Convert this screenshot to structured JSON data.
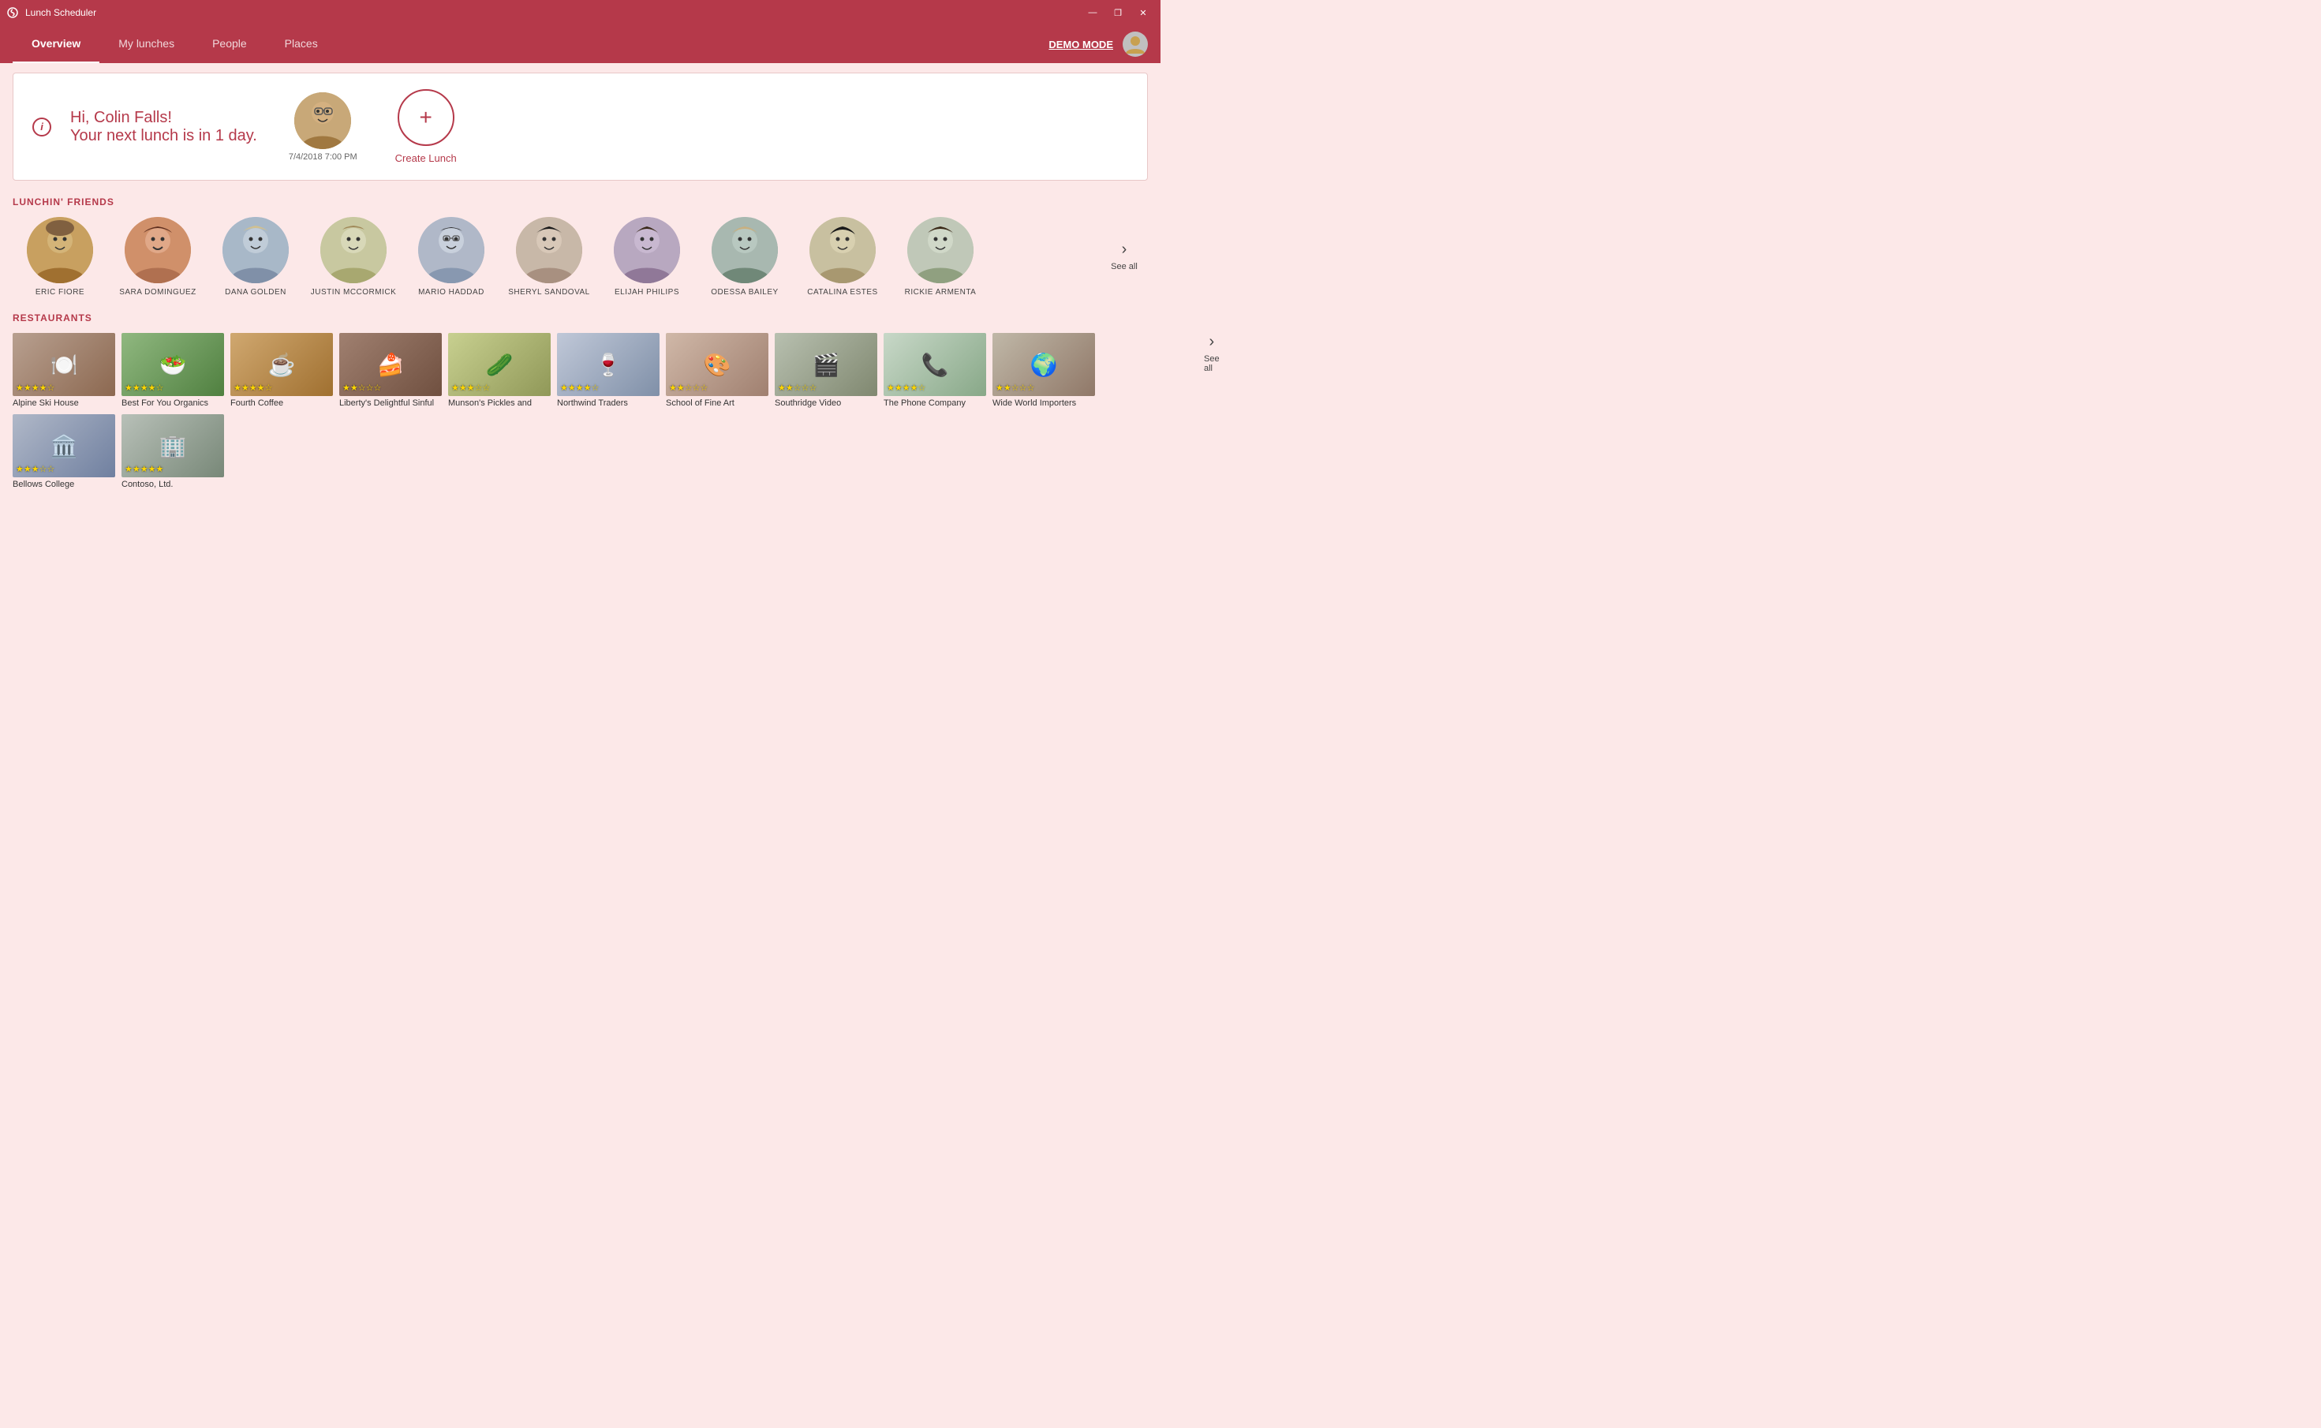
{
  "app": {
    "title": "Lunch Scheduler",
    "titlebar_controls": {
      "minimize": "—",
      "restore": "❐",
      "close": "✕"
    }
  },
  "nav": {
    "tabs": [
      {
        "id": "overview",
        "label": "Overview",
        "active": true
      },
      {
        "id": "my-lunches",
        "label": "My lunches",
        "active": false
      },
      {
        "id": "people",
        "label": "People",
        "active": false
      },
      {
        "id": "places",
        "label": "Places",
        "active": false
      }
    ],
    "demo_mode": "DEMO MODE"
  },
  "welcome": {
    "greeting": "Hi, Colin Falls!",
    "next_lunch": "Your next lunch is in",
    "days": "1 day.",
    "date": "7/4/2018 7:00 PM",
    "create_label": "Create Lunch"
  },
  "friends": {
    "section_title": "LUNCHIN' FRIENDS",
    "see_all": "See all",
    "people": [
      {
        "name": "ERIC FIORE",
        "bg": "bg-person1"
      },
      {
        "name": "SARA DOMINGUEZ",
        "bg": "bg-person2"
      },
      {
        "name": "DANA GOLDEN",
        "bg": "bg-person3"
      },
      {
        "name": "JUSTIN MCCORMICK",
        "bg": "bg-person4"
      },
      {
        "name": "MARIO HADDAD",
        "bg": "bg-person5"
      },
      {
        "name": "SHERYL SANDOVAL",
        "bg": "bg-person6"
      },
      {
        "name": "ELIJAH PHILIPS",
        "bg": "bg-person7"
      },
      {
        "name": "ODESSA BAILEY",
        "bg": "bg-person8"
      },
      {
        "name": "CATALINA ESTES",
        "bg": "bg-person9"
      },
      {
        "name": "RICKIE ARMENTA",
        "bg": "bg-person10"
      }
    ]
  },
  "restaurants": {
    "section_title": "RESTAURANTS",
    "see_all": "See all",
    "row1": [
      {
        "name": "Alpine Ski House",
        "stars": "★★★★☆",
        "bg": "rest-alpine",
        "emoji": "🍽️"
      },
      {
        "name": "Best For You Organics",
        "stars": "★★★★☆",
        "bg": "rest-best",
        "emoji": "🥗"
      },
      {
        "name": "Fourth Coffee",
        "stars": "★★★★☆",
        "bg": "rest-fourth",
        "emoji": "☕"
      },
      {
        "name": "Liberty's Delightful Sinful",
        "stars": "★★☆☆☆",
        "bg": "rest-liberty",
        "emoji": "🍰"
      },
      {
        "name": "Munson's Pickles and",
        "stars": "★★★☆☆",
        "bg": "rest-munson",
        "emoji": "🥒"
      },
      {
        "name": "Northwind Traders",
        "stars": "★★★★☆",
        "bg": "rest-northwind",
        "emoji": "🍷"
      },
      {
        "name": "School of Fine Art",
        "stars": "★★☆☆☆",
        "bg": "rest-school",
        "emoji": "🎨"
      },
      {
        "name": "Southridge Video",
        "stars": "★★☆☆☆",
        "bg": "rest-southridge",
        "emoji": "🎬"
      },
      {
        "name": "The Phone Company",
        "stars": "★★★★☆",
        "bg": "rest-phone",
        "emoji": "📱"
      },
      {
        "name": "Wide World Importers",
        "stars": "★★☆☆☆",
        "bg": "rest-wide",
        "emoji": "🌍"
      }
    ],
    "row2": [
      {
        "name": "Bellows College",
        "stars": "★★★☆☆",
        "bg": "rest-bellows",
        "emoji": "🏛️"
      },
      {
        "name": "Contoso, Ltd.",
        "stars": "★★★★★",
        "bg": "rest-contoso",
        "emoji": "🏢"
      }
    ]
  }
}
